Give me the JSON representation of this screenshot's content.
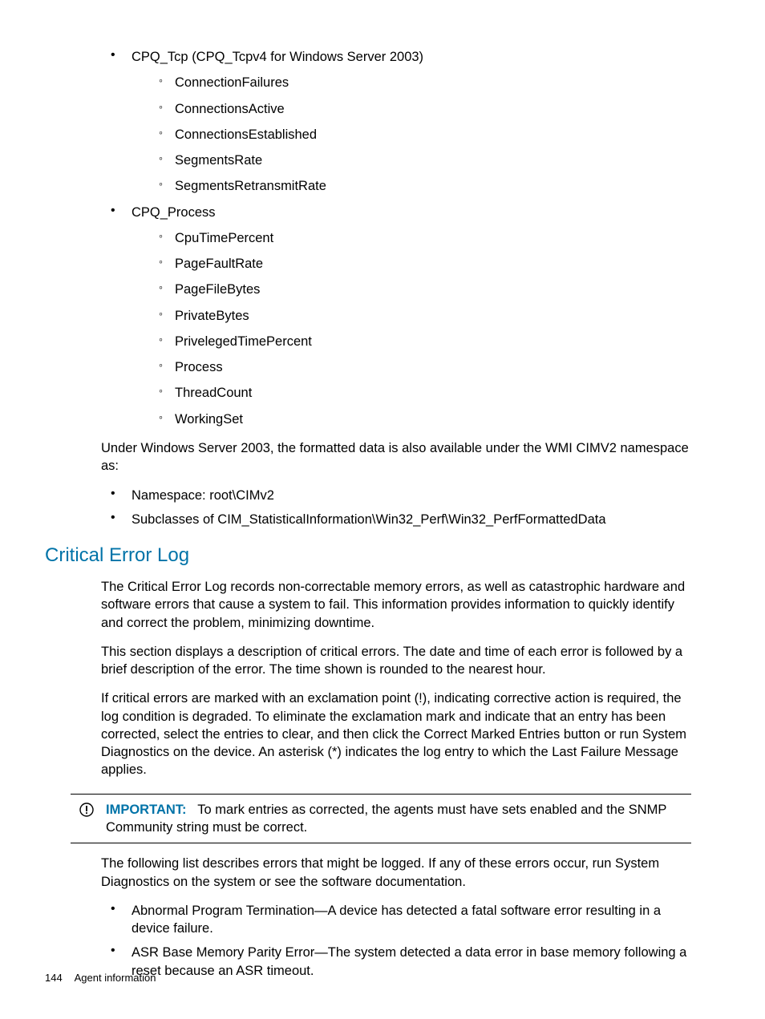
{
  "list1": {
    "item1": {
      "label": "CPQ_Tcp (CPQ_Tcpv4 for Windows Server 2003)",
      "sub": [
        "ConnectionFailures",
        "ConnectionsActive",
        "ConnectionsEstablished",
        "SegmentsRate",
        "SegmentsRetransmitRate"
      ]
    },
    "item2": {
      "label": "CPQ_Process",
      "sub": [
        "CpuTimePercent",
        "PageFaultRate",
        "PageFileBytes",
        "PrivateBytes",
        "PrivelegedTimePercent",
        "Process",
        "ThreadCount",
        "WorkingSet"
      ]
    }
  },
  "para1": "Under Windows Server 2003, the formatted data is also available under the WMI CIMV2 namespace as:",
  "list2": [
    "Namespace: root\\CIMv2",
    "Subclasses of CIM_StatisticalInformation\\Win32_Perf\\Win32_PerfFormattedData"
  ],
  "heading": "Critical Error Log",
  "para2": "The Critical Error Log records non-correctable memory errors, as well as catastrophic hardware and software errors that cause a system to fail. This information provides information to quickly identify and correct the problem, minimizing downtime.",
  "para3": "This section displays a description of critical errors. The date and time of each error is followed by a brief description of the error. The time shown is rounded to the nearest hour.",
  "para4": "If critical errors are marked with an exclamation point (!), indicating corrective action is required, the log condition is degraded. To eliminate the exclamation mark and indicate that an entry has been corrected, select the entries to clear, and then click the Correct Marked Entries button or run System Diagnostics on the device. An asterisk (*) indicates the log entry to which the Last Failure Message applies.",
  "important": {
    "label": "IMPORTANT:",
    "text": "To mark entries as corrected, the agents must have sets enabled and the SNMP Community string must be correct."
  },
  "para5": "The following list describes errors that might be logged. If any of these errors occur, run System Diagnostics on the system or see the software documentation.",
  "list3": [
    "Abnormal Program Termination—A device has detected a fatal software error resulting in a device failure.",
    "ASR Base Memory Parity Error—The system detected a data error in base memory following a reset because an ASR timeout."
  ],
  "footer": {
    "page": "144",
    "title": "Agent information"
  }
}
